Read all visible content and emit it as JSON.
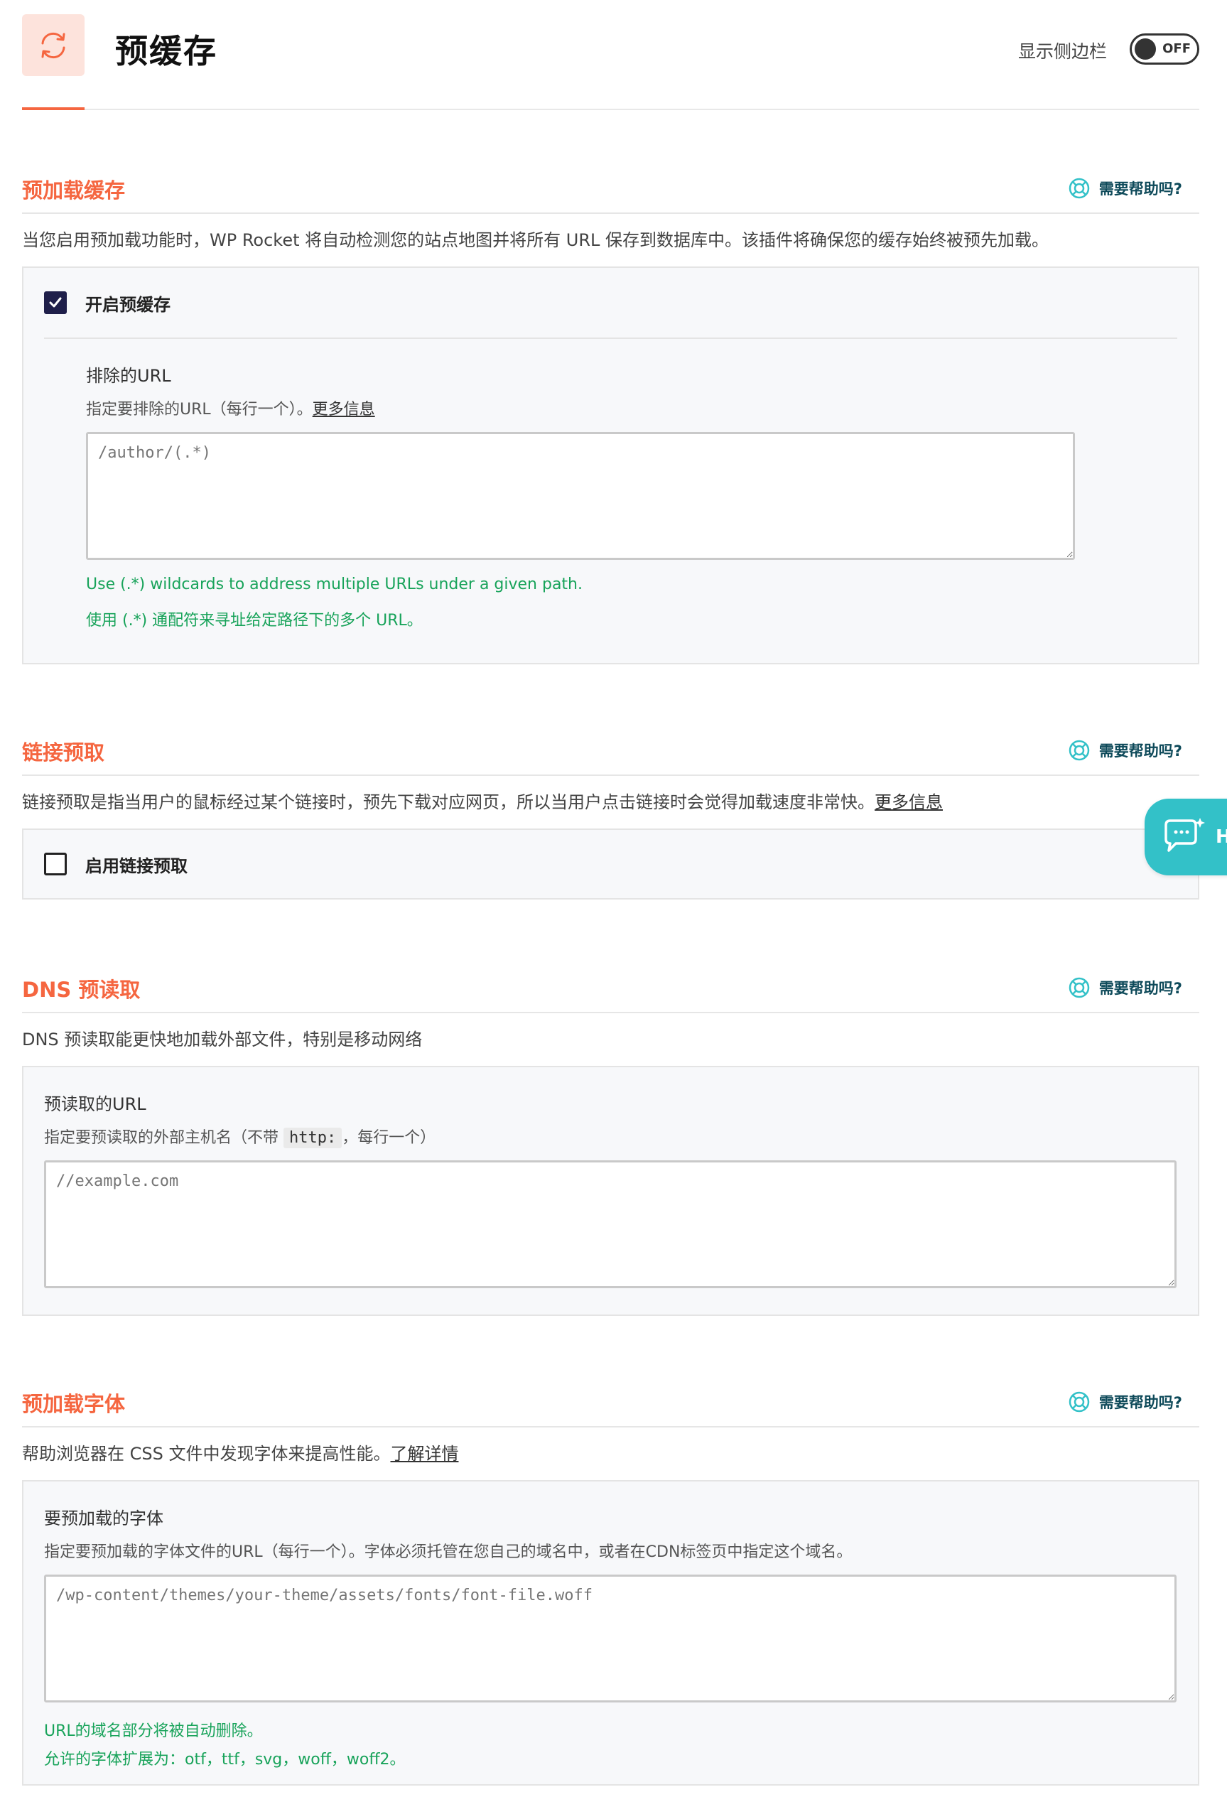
{
  "header": {
    "title": "预缓存",
    "sidebar_label": "显示侧边栏",
    "sidebar_toggle": "OFF"
  },
  "help_label": "需要帮助吗?",
  "preload": {
    "title": "预加载缓存",
    "description": "当您启用预加载功能时，WP Rocket 将自动检测您的站点地图并将所有 URL 保存到数据库中。该插件将确保您的缓存始终被预先加载。",
    "enable_label": "开启预缓存",
    "enable_checked": true,
    "exclude_title": "排除的URL",
    "exclude_sub": "指定要排除的URL（每行一个）。",
    "more_info": "更多信息",
    "exclude_placeholder": "/author/(.*)",
    "hint_en": "Use (.*) wildcards to address multiple URLs under a given path.",
    "hint_zh": "使用 (.*) 通配符来寻址给定路径下的多个 URL。"
  },
  "link_prefetch": {
    "title": "链接预取",
    "description": "链接预取是指当用户的鼠标经过某个链接时，预先下载对应网页，所以当用户点击链接时会觉得加载速度非常快。",
    "more_info": "更多信息",
    "enable_label": "启用链接预取",
    "enable_checked": false
  },
  "dns": {
    "title": "DNS 预读取",
    "description": "DNS 预读取能更快地加载外部文件，特别是移动网络",
    "field_title": "预读取的URL",
    "field_sub_before": "指定要预读取的外部主机名（不带 ",
    "field_sub_code": "http:",
    "field_sub_after": "，每行一个）",
    "placeholder": "//example.com"
  },
  "fonts": {
    "title": "预加载字体",
    "description": "帮助浏览器在 CSS 文件中发现字体来提高性能。",
    "learn_more": "了解详情",
    "field_title": "要预加载的字体",
    "field_sub": "指定要预加载的字体文件的URL（每行一个）。字体必须托管在您自己的域名中，或者在CDN标签页中指定这个域名。",
    "placeholder": "/wp-content/themes/your-theme/assets/fonts/font-file.woff",
    "hint1": "URL的域名部分将被自动删除。",
    "hint2": "允许的字体扩展为：otf，ttf，svg，woff，woff2。"
  },
  "chat": {
    "letter": "H"
  },
  "colors": {
    "accent": "#f56640",
    "success": "#18a35a",
    "chat": "#33c1c8"
  }
}
